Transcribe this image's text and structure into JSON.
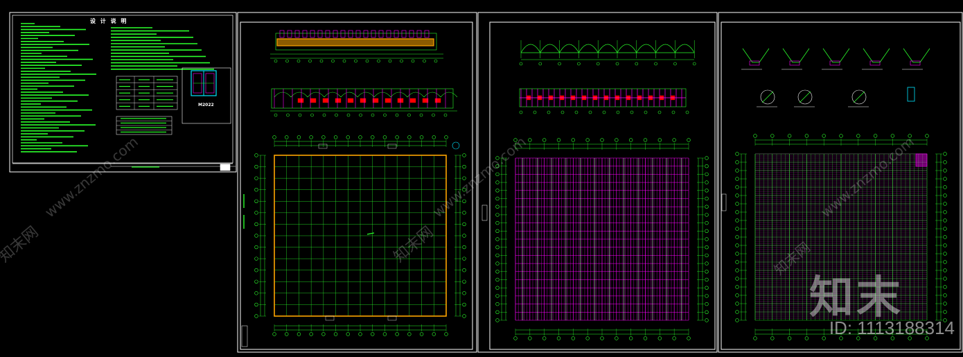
{
  "sheet1": {
    "title": "设 计 说 明",
    "door_label": "M2022"
  },
  "watermark": {
    "site_text": "www.znzmo.com",
    "brand": "知末网",
    "logo_text": "知末",
    "id_text": "ID: 1113188314"
  },
  "colors": {
    "background": "#000000",
    "frame": "#ffffff",
    "cad_green": "#2bff2b",
    "cad_magenta": "#ff00ff",
    "cad_orange": "#ffa500",
    "cad_red": "#ff0000",
    "cad_cyan": "#00e5ff"
  }
}
